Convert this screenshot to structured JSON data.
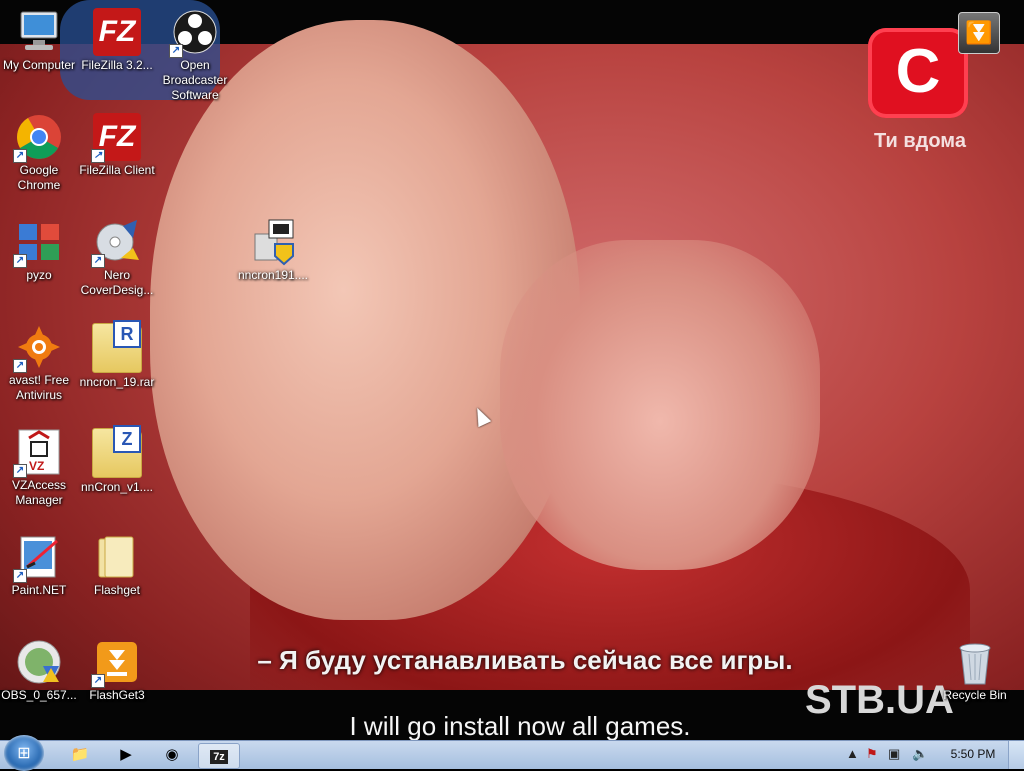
{
  "wallpaper": {
    "channel_logo": "C",
    "channel_tag": "Ти вдома",
    "subtitle_ru": "– Я буду устанавливать сейчас все игры.",
    "subtitle_en": "I will go install now all games.",
    "watermark": "STB.UA"
  },
  "desktop_icons": [
    {
      "label": "My Computer",
      "icon": "computer-icon"
    },
    {
      "label": "FileZilla 3.2...",
      "icon": "filezilla-icon"
    },
    {
      "label": "Open Broadcaster Software",
      "icon": "obs-icon"
    },
    {
      "label": "Google Chrome",
      "icon": "chrome-icon"
    },
    {
      "label": "FileZilla Client",
      "icon": "filezilla-icon"
    },
    {
      "label": "pyzo",
      "icon": "pyzo-icon"
    },
    {
      "label": "Nero CoverDesig...",
      "icon": "nero-icon"
    },
    {
      "label": "nncron191....",
      "icon": "installer-icon"
    },
    {
      "label": "avast! Free Antivirus",
      "icon": "avast-icon"
    },
    {
      "label": "nncron_19.rar",
      "icon": "rar-archive-icon"
    },
    {
      "label": "VZAccess Manager",
      "icon": "vzaccess-icon"
    },
    {
      "label": "nnCron_v1....",
      "icon": "zip-archive-icon"
    },
    {
      "label": "Paint.NET",
      "icon": "paintnet-icon"
    },
    {
      "label": "Flashget",
      "icon": "folder-icon"
    },
    {
      "label": "OBS_0_657...",
      "icon": "obs-installer-icon"
    },
    {
      "label": "FlashGet3",
      "icon": "flashget-icon"
    },
    {
      "label": "Recycle Bin",
      "icon": "recycle-bin-icon"
    }
  ],
  "taskbar": {
    "start_label": "Start",
    "pinned": [
      "explorer-icon",
      "media-player-icon",
      "chrome-icon",
      "7zip-icon"
    ],
    "active_app": "7z",
    "clock": "5:50 PM"
  },
  "colors": {
    "taskbar": "#b7cce6",
    "filezilla": "#c41818",
    "channel_logo": "#e01020"
  }
}
